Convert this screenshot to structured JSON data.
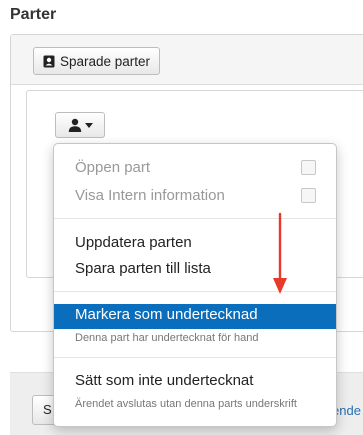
{
  "section": {
    "title": "Parter"
  },
  "toolbar": {
    "saved_parties_label": "Sparade parter",
    "saved_parties_icon": "contact-card-icon"
  },
  "party": {
    "menu_icon": "user-icon",
    "menu_caret": "caret-down-icon"
  },
  "dropdown": {
    "open_party": {
      "label": "Öppen part",
      "checked": false
    },
    "show_internal": {
      "label": "Visa Intern information",
      "checked": false
    },
    "update_party": {
      "label": "Uppdatera parten"
    },
    "save_party_to_list": {
      "label": "Spara parten till lista"
    },
    "mark_signed": {
      "label": "Markera som undertecknad",
      "subtext": "Denna part har undertecknat för hand"
    },
    "set_unsigned": {
      "label": "Sätt som inte undertecknat",
      "subtext": "Ärendet avslutas utan denna parts underskrift"
    }
  },
  "footer": {
    "button_label": "S",
    "link_text": "ende"
  },
  "colors": {
    "highlight": "#0a6ebd",
    "annotation_arrow": "#e8392a",
    "link": "#2a6fb0"
  }
}
